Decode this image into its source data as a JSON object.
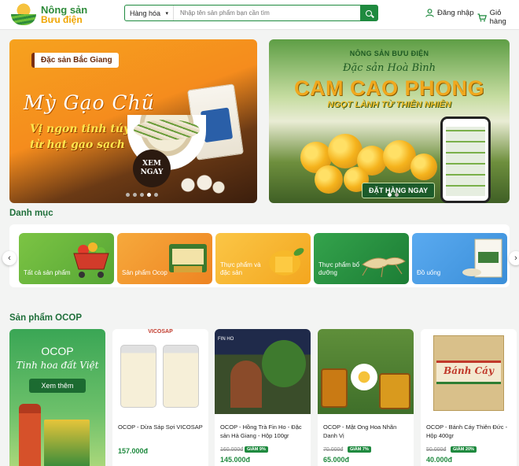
{
  "header": {
    "logo_line1": "Nông sản",
    "logo_line2": "Bưu điện",
    "search_category": "Hàng hóa",
    "search_placeholder": "Nhập tên sản phẩm bạn cần tìm",
    "login_label": "Đăng nhập",
    "cart_label": "Giỏ hàng"
  },
  "banner_left": {
    "tag": "Đặc sản Bắc Giang",
    "title": "Mỳ Gạo Chũ",
    "tagline": "Vị ngon tinh túy từ hạt gạo sạch",
    "cta": "XEM NGAY",
    "slide_count": 5,
    "active_slide": 3
  },
  "banner_right": {
    "brand": "NÔNG SẢN BƯU ĐIỆN",
    "subtitle": "Đặc sản Hoà Bình",
    "title": "CAM CAO PHONG",
    "slogan": "NGỌT LÀNH TỪ THIÊN NHIÊN",
    "cta": "ĐẶT HÀNG NGAY",
    "slide_count": 2,
    "active_slide": 0
  },
  "categories": {
    "title": "Danh mục",
    "items": [
      {
        "label": "Tất cả sản phẩm",
        "color": "#6bb83a"
      },
      {
        "label": "Sản phẩm Ocop",
        "color": "#f39a2c"
      },
      {
        "label": "Thực phẩm và đặc sản",
        "color": "#f7b52a"
      },
      {
        "label": "Thực phẩm bổ dưỡng",
        "color": "#2a9a44"
      },
      {
        "label": "Đồ uống",
        "color": "#4a9ee0"
      }
    ]
  },
  "products": {
    "title": "Sản phẩm OCOP",
    "promo_title": "OCOP",
    "promo_subtitle": "Tinh hoa đất Việt",
    "promo_button": "Xem thêm",
    "items": [
      {
        "name": "OCOP - Dừa Sáp Sợi VICOSAP",
        "old_price": "",
        "discount": "",
        "price": "157.000đ",
        "image_label": "VICOSAP"
      },
      {
        "name": "OCOP - Hồng Trà Fin Ho - Đặc sản Hà Giang - Hộp 100gr",
        "old_price": "160.000đ",
        "discount": "GIẢM 9%",
        "price": "145.000đ",
        "image_label": "FIN HO"
      },
      {
        "name": "OCOP - Mật Ong Hoa Nhãn Danh Vị",
        "old_price": "70.000đ",
        "discount": "GIẢM 7%",
        "price": "65.000đ",
        "image_label": ""
      },
      {
        "name": "OCOP - Bánh Cáy Thiên Đức - Hộp 400gr",
        "old_price": "50.000đ",
        "discount": "GIẢM 20%",
        "price": "40.000đ",
        "image_label": "Bánh Cáy"
      }
    ]
  },
  "colors": {
    "brand_green": "#1f8a3f",
    "brand_orange": "#f0a500"
  }
}
